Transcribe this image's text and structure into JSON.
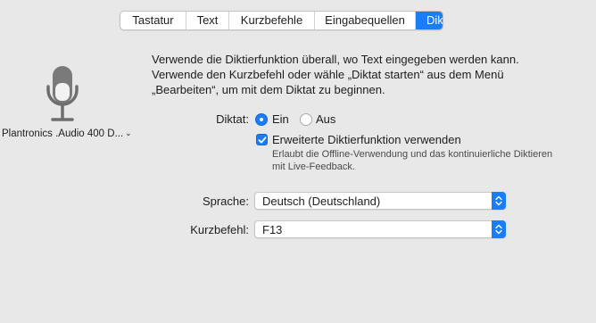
{
  "tabs": [
    {
      "label": "Tastatur",
      "active": false
    },
    {
      "label": "Text",
      "active": false
    },
    {
      "label": "Kurzbefehle",
      "active": false
    },
    {
      "label": "Eingabequellen",
      "active": false
    },
    {
      "label": "Diktat",
      "active": true
    }
  ],
  "microphone": {
    "icon": "microphone-icon",
    "device_label": "Plantronics .Audio 400 D...",
    "chevron": "chevron-down-icon"
  },
  "description": {
    "line1": "Verwende die Diktierfunktion überall, wo Text eingegeben werden kann.",
    "line2": "Verwende den Kurzbefehl oder wähle „Diktat starten“ aus dem Menü",
    "line3": "„Bearbeiten“, um mit dem Diktat zu beginnen."
  },
  "dictation": {
    "label": "Diktat:",
    "on_label": "Ein",
    "off_label": "Aus",
    "selected": "Ein"
  },
  "enhanced": {
    "label": "Erweiterte Diktierfunktion verwenden",
    "checked": true,
    "help_line1": "Erlaubt die Offline-Verwendung und das kontinuierliche Diktieren",
    "help_line2": "mit Live-Feedback."
  },
  "language": {
    "label": "Sprache:",
    "value": "Deutsch (Deutschland)"
  },
  "shortcut": {
    "label": "Kurzbefehl:",
    "value": "F13"
  },
  "colors": {
    "accent": "#1b7cf8",
    "background": "#e8e8e8"
  }
}
